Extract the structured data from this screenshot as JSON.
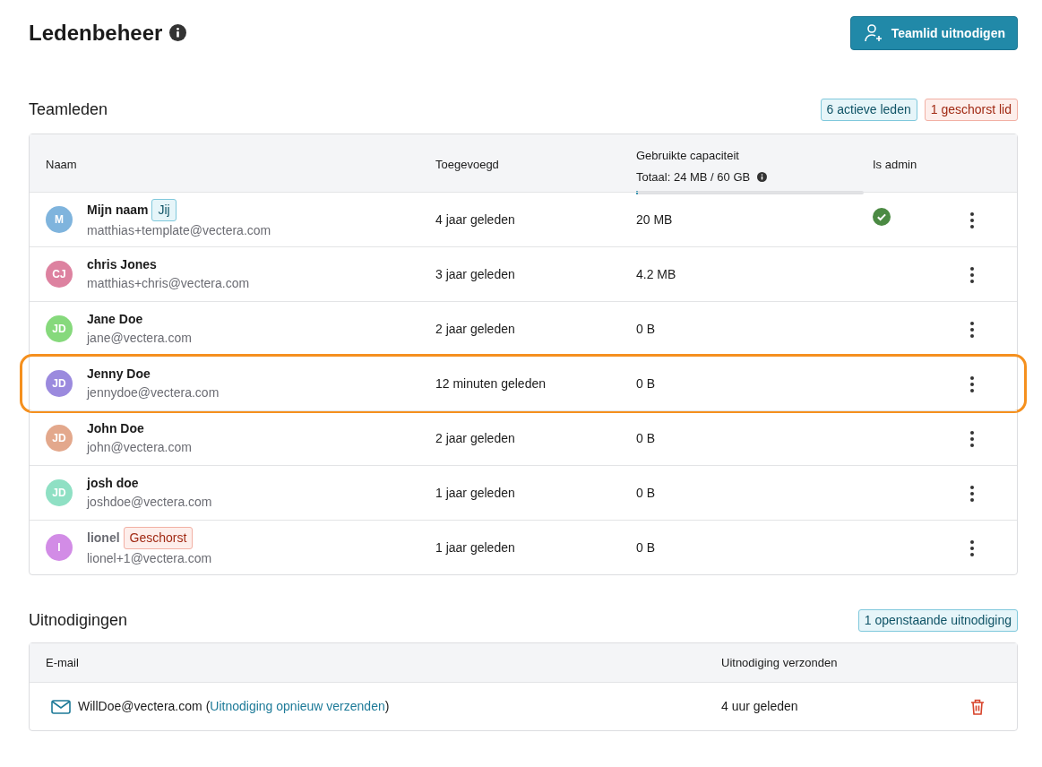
{
  "page": {
    "title": "Ledenbeheer",
    "invite_button": "Teamlid uitnodigen"
  },
  "members_section": {
    "title": "Teamleden",
    "badges": [
      {
        "text": "6 actieve leden",
        "kind": "info"
      },
      {
        "text": "1 geschorst lid",
        "kind": "danger"
      }
    ],
    "columns": {
      "name": "Naam",
      "added": "Toegevoegd",
      "capacity": "Gebruikte capaciteit",
      "capacity_total": "Totaal: 24 MB / 60 GB",
      "capacity_bar": {
        "level": 0.004
      },
      "admin": "Is admin"
    },
    "rows": [
      {
        "initials": "M",
        "color": "#7fb4dd",
        "name": "Mijn naam",
        "tag": {
          "text": "Jij",
          "kind": "you"
        },
        "email": "matthias+template@vectera.com",
        "added": "4 jaar geleden",
        "used": "20 MB",
        "admin": true,
        "suspended": false,
        "highlighted": false
      },
      {
        "initials": "CJ",
        "color": "#dd82a0",
        "name": "chris Jones",
        "email": "matthias+chris@vectera.com",
        "added": "3 jaar geleden",
        "used": "4.2 MB",
        "admin": false,
        "suspended": false,
        "highlighted": false
      },
      {
        "initials": "JD",
        "color": "#86d97c",
        "name": "Jane Doe",
        "email": "jane@vectera.com",
        "added": "2 jaar geleden",
        "used": "0 B",
        "admin": false,
        "suspended": false,
        "highlighted": false
      },
      {
        "initials": "JD",
        "color": "#9b8ade",
        "name": "Jenny Doe",
        "email": "jennydoe@vectera.com",
        "added": "12 minuten geleden",
        "used": "0 B",
        "admin": false,
        "suspended": false,
        "highlighted": true
      },
      {
        "initials": "JD",
        "color": "#e3a88c",
        "name": "John Doe",
        "email": "john@vectera.com",
        "added": "2 jaar geleden",
        "used": "0 B",
        "admin": false,
        "suspended": false,
        "highlighted": false
      },
      {
        "initials": "JD",
        "color": "#8fe0c4",
        "name": "josh doe",
        "email": "joshdoe@vectera.com",
        "added": "1 jaar geleden",
        "used": "0 B",
        "admin": false,
        "suspended": false,
        "highlighted": false
      },
      {
        "initials": "I",
        "color": "#d28ce6",
        "name": "lionel",
        "tag": {
          "text": "Geschorst",
          "kind": "suspended"
        },
        "email": "lionel+1@vectera.com",
        "added": "1 jaar geleden",
        "used": "0 B",
        "admin": false,
        "suspended": true,
        "highlighted": false
      }
    ]
  },
  "invites_section": {
    "title": "Uitnodigingen",
    "badge": "1 openstaande uitnodiging",
    "columns": {
      "email": "E-mail",
      "sent": "Uitnodiging verzonden"
    },
    "rows": [
      {
        "email": "WillDoe@vectera.com",
        "open_paren": "(",
        "resend_link": "Uitnodiging opnieuw verzenden",
        "close_paren": ")",
        "sent": "4 uur geleden"
      }
    ]
  }
}
